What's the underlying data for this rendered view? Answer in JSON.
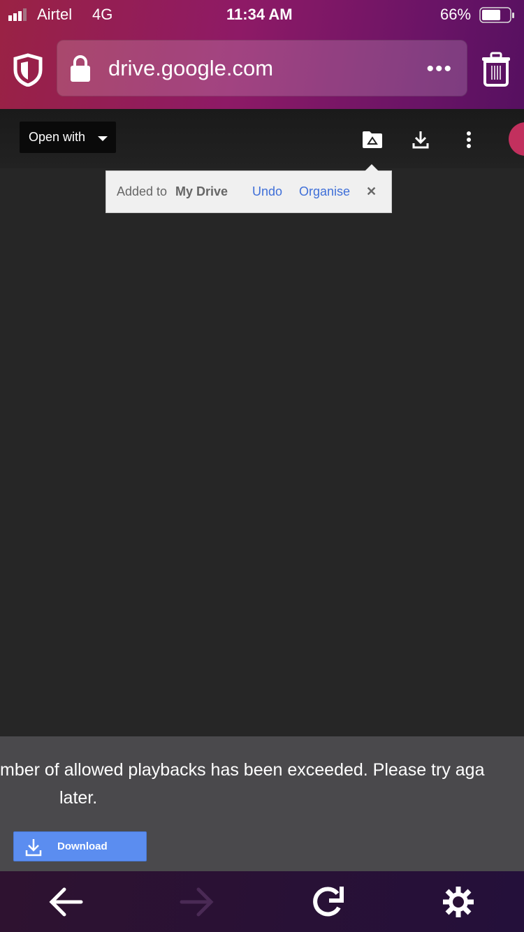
{
  "status_bar": {
    "carrier": "Airtel",
    "network": "4G",
    "time": "11:34 AM",
    "battery": "66%",
    "battery_level": 0.66
  },
  "browser": {
    "url": "drive.google.com",
    "more": "•••"
  },
  "toolbar": {
    "open_with": "Open with"
  },
  "toast": {
    "prefix": "Added to",
    "location": "My Drive",
    "undo": "Undo",
    "organise": "Organise",
    "close": "✕"
  },
  "message": {
    "line1": "mber of allowed playbacks has been exceeded. Please try aga",
    "line2": "later.",
    "download": "Download"
  },
  "colors": {
    "accent": "#5b8df0",
    "link": "#3f6fd8"
  }
}
